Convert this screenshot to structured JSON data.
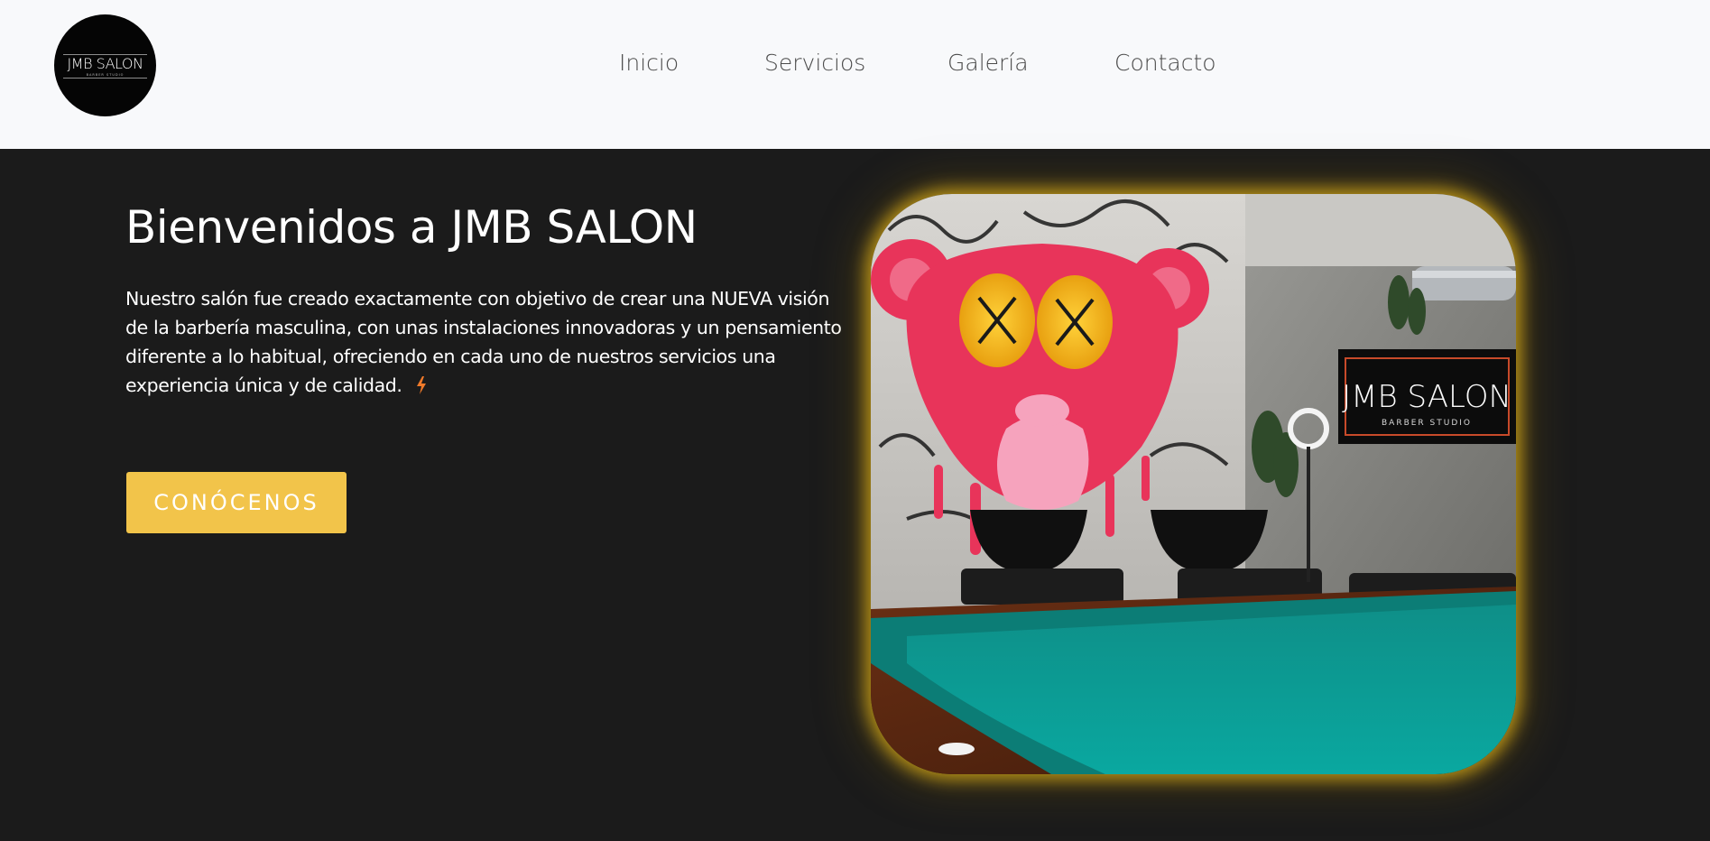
{
  "brand": {
    "logo_text": "JMB SALON",
    "logo_subtext": "BARBER STUDIO"
  },
  "nav": {
    "items": [
      {
        "label": "Inicio"
      },
      {
        "label": "Servicios"
      },
      {
        "label": "Galería"
      },
      {
        "label": "Contacto"
      }
    ]
  },
  "hero": {
    "title": "Bienvenidos a JMB SALON",
    "description": "Nuestro salón fue creado exactamente con objetivo de crear una NUEVA visión de la barbería masculina, con unas instalaciones innovadoras y un pensamiento diferente a lo habitual, ofreciendo en cada uno de nuestros servicios una experiencia única y de calidad.",
    "cta_label": "CONÓCENOS",
    "image": {
      "sign_text": "JMB SALON",
      "sign_subtext": "BARBER STUDIO"
    }
  },
  "colors": {
    "header_bg": "#f8f9fb",
    "hero_bg": "#1b1b1b",
    "accent": "#f2c44a",
    "glow": "#e0b218",
    "bolt": "#f07a2a"
  },
  "icons": {
    "bolt": "lightning-bolt-icon"
  }
}
